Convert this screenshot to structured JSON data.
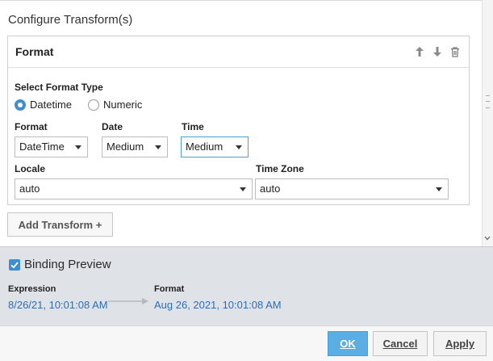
{
  "configure": {
    "title": "Configure Transform(s)"
  },
  "transform": {
    "title": "Format",
    "select_type_label": "Select Format Type",
    "radio_datetime": "Datetime",
    "radio_numeric": "Numeric",
    "selected_type": "Datetime",
    "format_label": "Format",
    "format_value": "DateTime",
    "date_label": "Date",
    "date_value": "Medium",
    "time_label": "Time",
    "time_value": "Medium",
    "locale_label": "Locale",
    "locale_value": "auto",
    "timezone_label": "Time Zone",
    "timezone_value": "auto",
    "header_icons": [
      "arrow-up-icon",
      "arrow-down-icon",
      "trash-icon"
    ]
  },
  "add_transform_label": "Add Transform +",
  "preview": {
    "checkbox_checked": true,
    "title": "Binding Preview",
    "expression_label": "Expression",
    "expression_value": "8/26/21, 10:01:08 AM",
    "format_label": "Format",
    "format_value": "Aug 26, 2021, 10:01:08 AM"
  },
  "footer": {
    "ok_label": "OK",
    "cancel_label": "Cancel",
    "apply_label": "Apply"
  },
  "colors": {
    "accent": "#3f8fd0",
    "ok_button": "#5aaee6",
    "preview_background": "#dfe3e8",
    "link_value": "#2a6ebb"
  }
}
